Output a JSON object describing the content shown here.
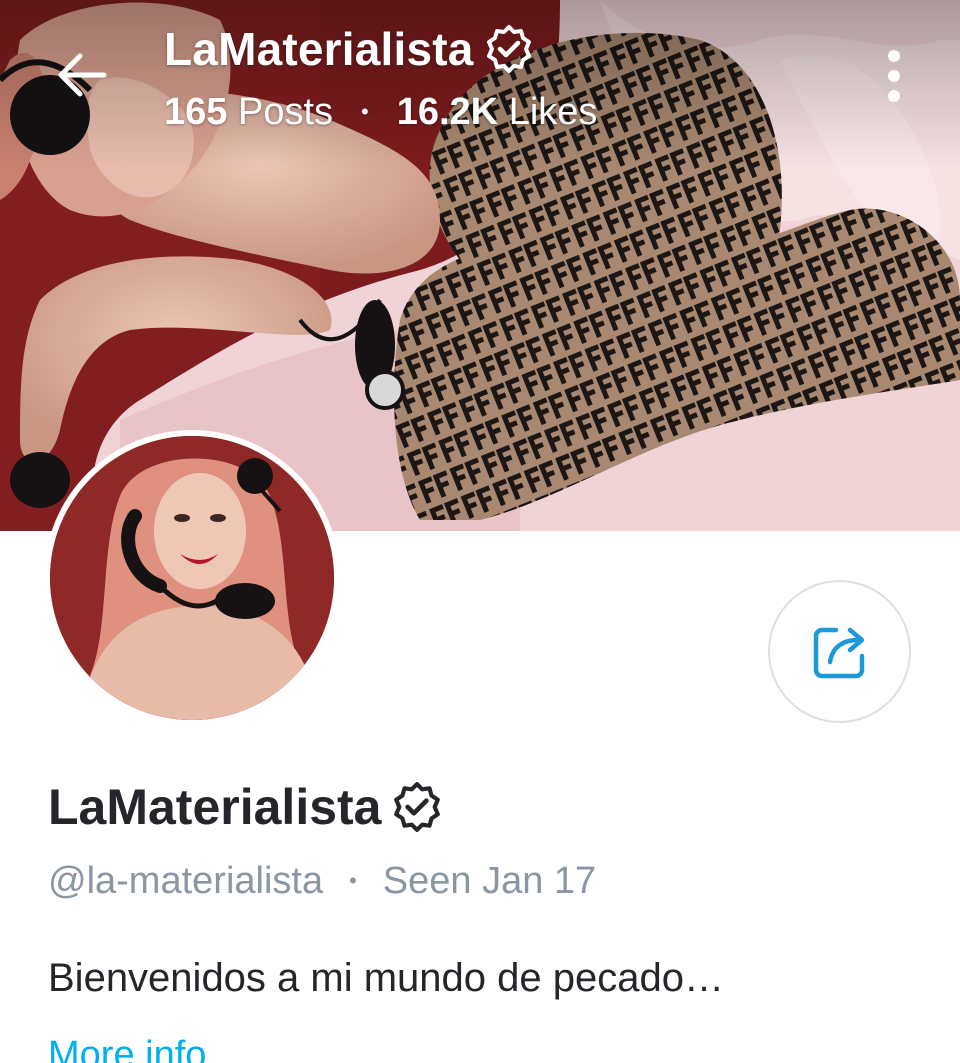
{
  "header": {
    "title": "LaMaterialista",
    "posts_count": "165",
    "posts_label": "Posts",
    "likes_count": "16.2K",
    "likes_label": "Likes"
  },
  "profile": {
    "display_name": "LaMaterialista",
    "handle": "@la-materialista",
    "last_seen": "Seen Jan 17",
    "bio": "Bienvenidos a mi mundo de pecado…",
    "more_info_label": "More info"
  },
  "icons": {
    "back": "back-arrow-icon",
    "more": "more-vertical-icon",
    "verified": "verified-badge-icon",
    "share": "share-icon"
  },
  "colors": {
    "accent": "#00aff0",
    "name_text": "#24262b",
    "muted_text": "#8a96a3",
    "share_icon": "#1a9ad9",
    "cover_wall": "#7a1a1c"
  }
}
